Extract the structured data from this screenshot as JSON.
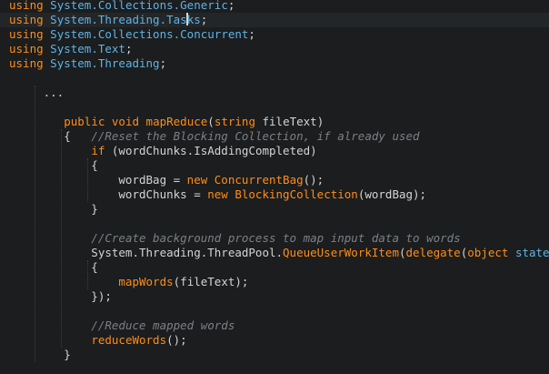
{
  "colors": {
    "background": "#1b1d1e",
    "current_line": "#232628",
    "default": "#d4d4d4",
    "keyword": "#ff8c1a",
    "namespace": "#5fb3e6",
    "type": "#ff8c1a",
    "comment": "#7c8087",
    "method": "#ff8c1a",
    "param": "#d4d4d4"
  },
  "editor": {
    "cursor_line": 1,
    "lines": [
      [
        [
          "using",
          "keyword"
        ],
        [
          " ",
          "default"
        ],
        [
          "System.Collections.Generic",
          "namespace"
        ],
        [
          ";",
          "default"
        ]
      ],
      [
        [
          "using",
          "keyword"
        ],
        [
          " ",
          "default"
        ],
        [
          "System.Threading.Tas",
          "namespace"
        ],
        [
          "|cursor|",
          "cursor"
        ],
        [
          "ks",
          "namespace"
        ],
        [
          ";",
          "default"
        ]
      ],
      [
        [
          "using",
          "keyword"
        ],
        [
          " ",
          "default"
        ],
        [
          "System.Collections.Concurrent",
          "namespace"
        ],
        [
          ";",
          "default"
        ]
      ],
      [
        [
          "using",
          "keyword"
        ],
        [
          " ",
          "default"
        ],
        [
          "System.Text",
          "namespace"
        ],
        [
          ";",
          "default"
        ]
      ],
      [
        [
          "using",
          "keyword"
        ],
        [
          " ",
          "default"
        ],
        [
          "System.Threading",
          "namespace"
        ],
        [
          ";",
          "default"
        ]
      ],
      [],
      [
        [
          "     ...",
          "default"
        ]
      ],
      [],
      [
        [
          "        ",
          "default"
        ],
        [
          "public",
          "keyword"
        ],
        [
          " ",
          "default"
        ],
        [
          "void",
          "keyword"
        ],
        [
          " ",
          "default"
        ],
        [
          "mapReduce",
          "method"
        ],
        [
          "(",
          "default"
        ],
        [
          "string",
          "keyword"
        ],
        [
          " fileText)",
          "default"
        ]
      ],
      [
        [
          "        {   ",
          "default"
        ],
        [
          "//Reset the Blocking Collection, if already used",
          "comment"
        ]
      ],
      [
        [
          "            ",
          "default"
        ],
        [
          "if",
          "keyword"
        ],
        [
          " (wordChunks.IsAddingCompleted)",
          "default"
        ]
      ],
      [
        [
          "            {",
          "default"
        ]
      ],
      [
        [
          "                wordBag = ",
          "default"
        ],
        [
          "new",
          "keyword"
        ],
        [
          " ",
          "default"
        ],
        [
          "ConcurrentBag",
          "type"
        ],
        [
          "();",
          "default"
        ]
      ],
      [
        [
          "                wordChunks = ",
          "default"
        ],
        [
          "new",
          "keyword"
        ],
        [
          " ",
          "default"
        ],
        [
          "BlockingCollection",
          "type"
        ],
        [
          "(wordBag);",
          "default"
        ]
      ],
      [
        [
          "            }",
          "default"
        ]
      ],
      [],
      [
        [
          "            ",
          "default"
        ],
        [
          "//Create background process to map input data to words",
          "comment"
        ]
      ],
      [
        [
          "            System.Threading.ThreadPool.",
          "default"
        ],
        [
          "QueueUserWorkItem",
          "method"
        ],
        [
          "(",
          "default"
        ],
        [
          "delegate",
          "keyword"
        ],
        [
          "(",
          "default"
        ],
        [
          "object",
          "keyword"
        ],
        [
          " ",
          "default"
        ],
        [
          "state",
          "namespace"
        ],
        [
          ")",
          "default"
        ]
      ],
      [
        [
          "            {",
          "default"
        ]
      ],
      [
        [
          "                ",
          "default"
        ],
        [
          "mapWords",
          "method"
        ],
        [
          "(fileText);",
          "default"
        ]
      ],
      [
        [
          "            });",
          "default"
        ]
      ],
      [],
      [
        [
          "            ",
          "default"
        ],
        [
          "//Reduce mapped words",
          "comment"
        ]
      ],
      [
        [
          "            ",
          "default"
        ],
        [
          "reduceWords",
          "method"
        ],
        [
          "();",
          "default"
        ]
      ],
      [
        [
          "        }",
          "default"
        ]
      ]
    ]
  }
}
